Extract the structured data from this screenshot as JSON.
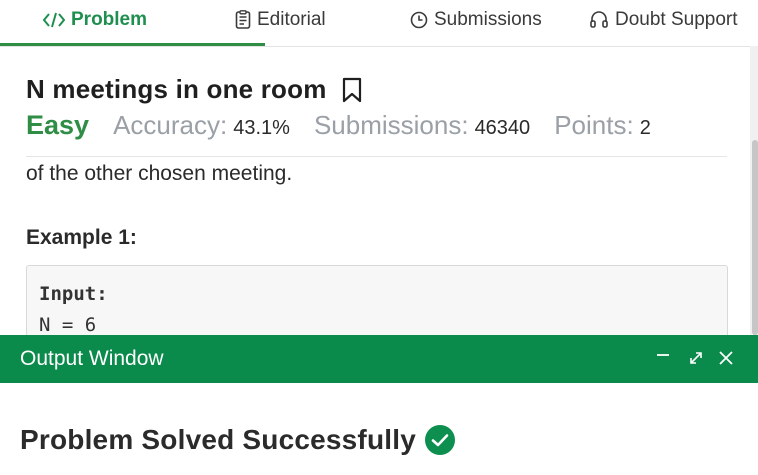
{
  "tabs": [
    {
      "label": "Problem",
      "icon": "code-icon",
      "active": true
    },
    {
      "label": "Editorial",
      "icon": "document-icon",
      "active": false
    },
    {
      "label": "Submissions",
      "icon": "clock-icon",
      "active": false
    },
    {
      "label": "Doubt Support",
      "icon": "headset-icon",
      "active": false
    }
  ],
  "problem": {
    "title": "N meetings in one room",
    "difficulty": "Easy",
    "accuracy_label": "Accuracy:",
    "accuracy_value": "43.1%",
    "submissions_label": "Submissions:",
    "submissions_value": "46340",
    "points_label": "Points:",
    "points_value": "2",
    "description_fragment": "of the other chosen meeting.",
    "example_title": "Example 1:",
    "example_input_label": "Input:",
    "example_input_line": "N = 6"
  },
  "output_window": {
    "title": "Output Window",
    "result": "Problem Solved Successfully"
  },
  "colors": {
    "brand_green": "#2f8d46",
    "header_green": "#0a8a4b",
    "success_green": "#0d8f4f"
  }
}
